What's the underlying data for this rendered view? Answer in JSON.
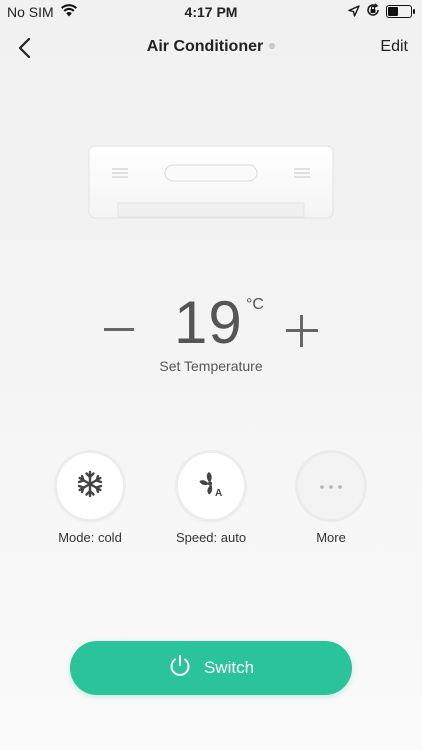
{
  "status_bar": {
    "carrier": "No SIM",
    "time": "4:17 PM",
    "battery_level": 0.45,
    "icons": [
      "wifi-icon",
      "location-arrow-icon",
      "orientation-lock-icon",
      "battery-icon"
    ]
  },
  "navbar": {
    "back_icon": "chevron-left-icon",
    "title": "Air Conditioner",
    "edit_label": "Edit"
  },
  "device": {
    "image": "air-conditioner-unit"
  },
  "temperature": {
    "value": "19",
    "unit": "°C",
    "label": "Set Temperature",
    "decrease_icon": "minus-icon",
    "increase_icon": "plus-icon"
  },
  "controls": [
    {
      "label": "Mode: cold",
      "icon": "snowflake-icon"
    },
    {
      "label": "Speed: auto",
      "icon": "fan-auto-icon"
    },
    {
      "label": "More",
      "icon": "more-dots-icon"
    }
  ],
  "power": {
    "label": "Switch",
    "icon": "power-icon",
    "color": "#2bc39a"
  }
}
